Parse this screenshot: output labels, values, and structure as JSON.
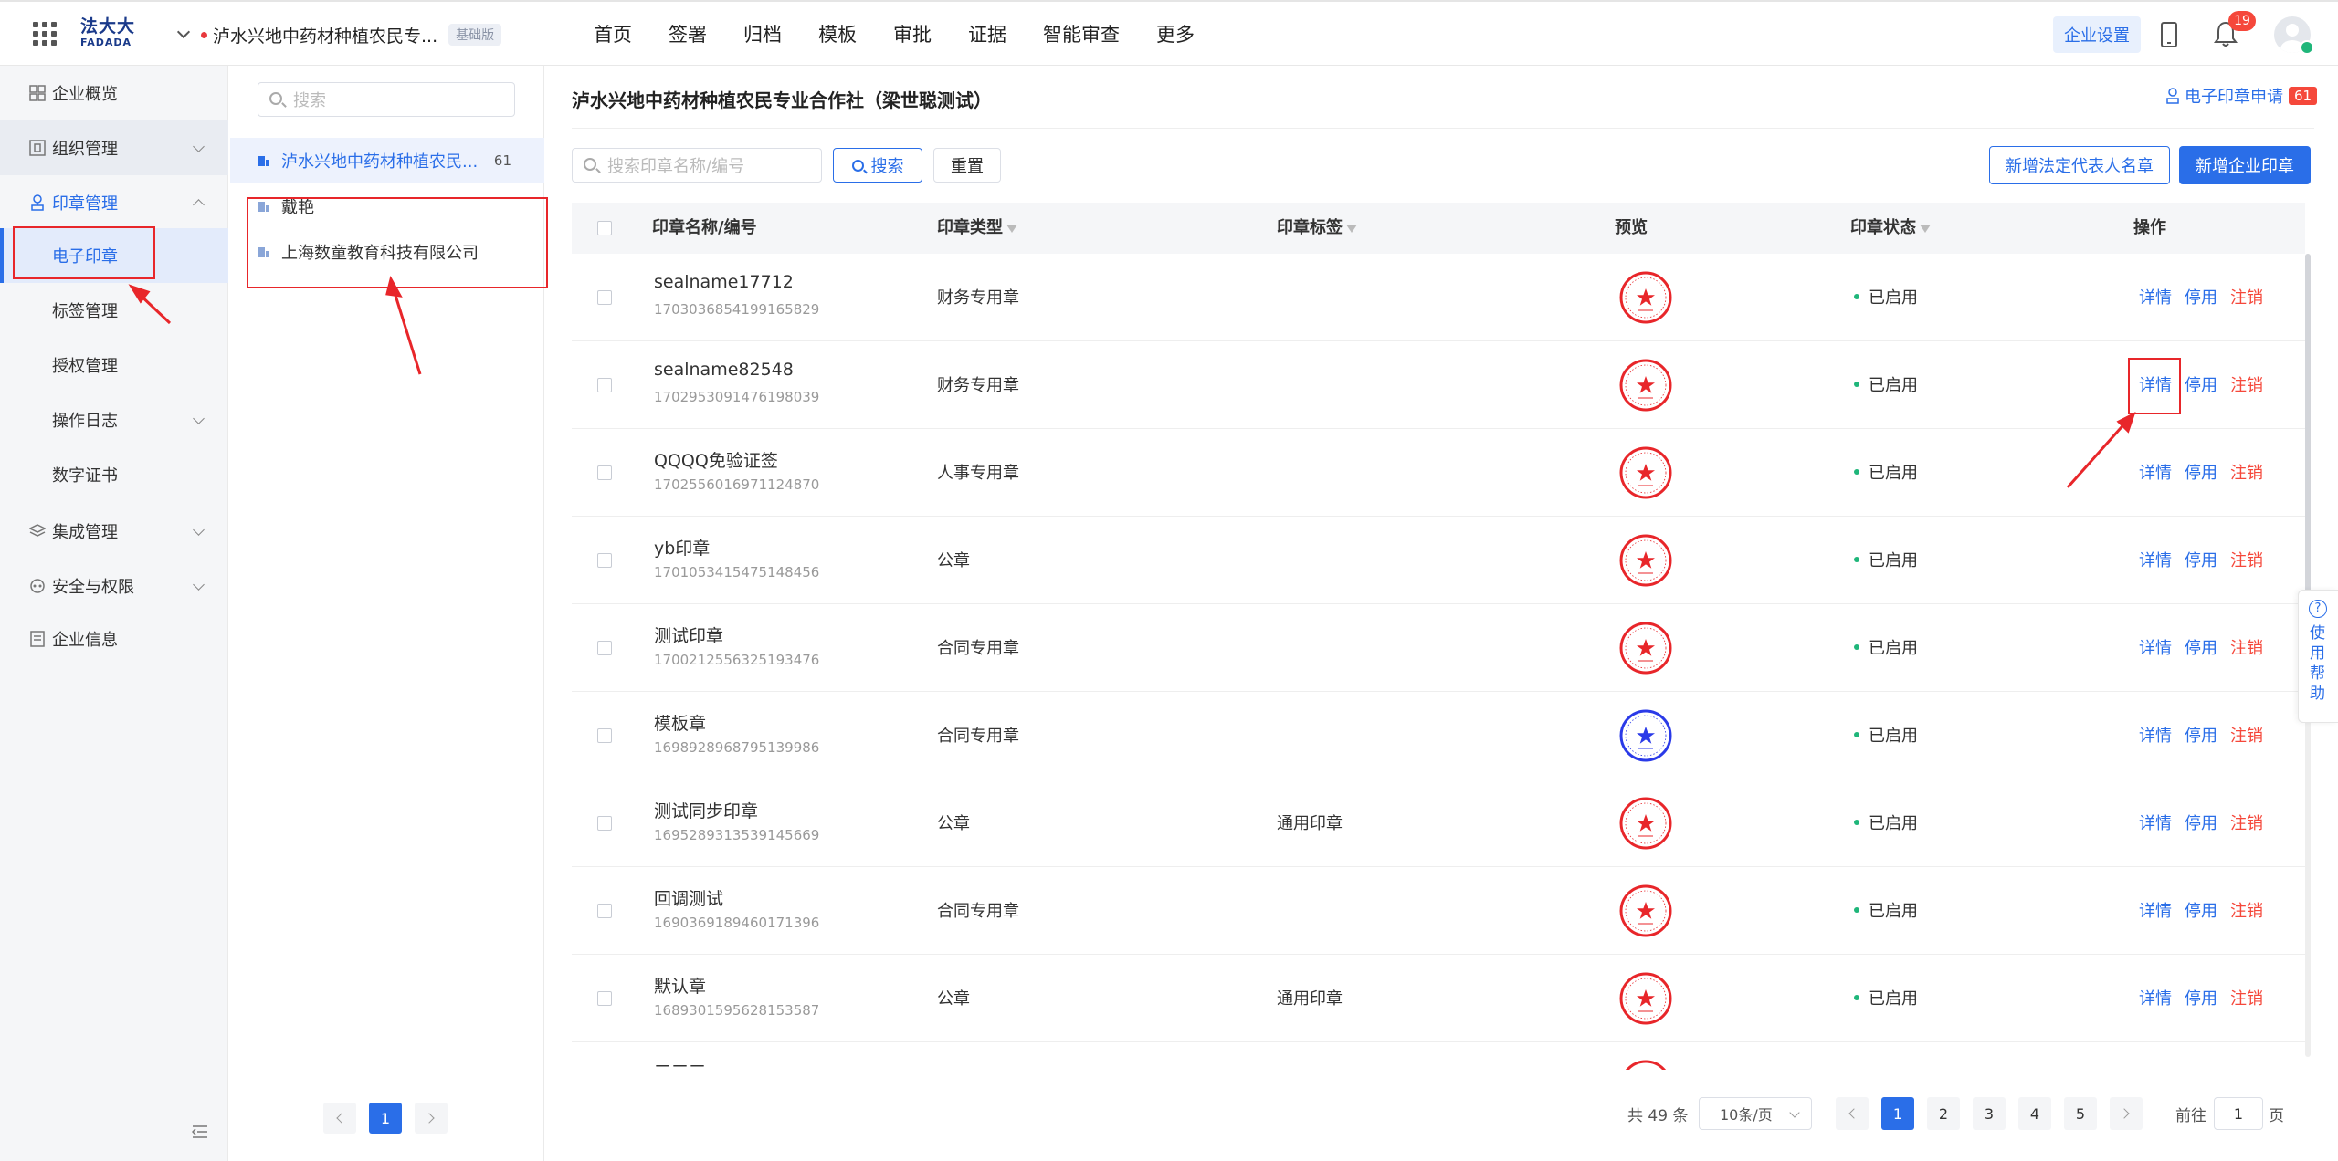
{
  "topbar": {
    "logo_cn": "法大大",
    "logo_en": "FADADA",
    "org_name": "泸水兴地中药材种植农民专...",
    "plan_badge": "基础版",
    "nav": [
      "首页",
      "签署",
      "归档",
      "模板",
      "审批",
      "证据",
      "智能审查",
      "更多"
    ],
    "settings_label": "企业设置",
    "notification_count": "19"
  },
  "sidebar": {
    "items": [
      {
        "label": "企业概览",
        "icon": "overview-icon"
      },
      {
        "label": "组织管理",
        "icon": "org-icon"
      },
      {
        "label": "印章管理",
        "icon": "seal-icon"
      },
      {
        "label": "集成管理",
        "icon": "layers-icon"
      },
      {
        "label": "安全与权限",
        "icon": "security-icon"
      },
      {
        "label": "企业信息",
        "icon": "info-icon"
      }
    ],
    "seal_sub": [
      "电子印章",
      "标签管理",
      "授权管理",
      "操作日志",
      "数字证书"
    ]
  },
  "org_tree": {
    "search_placeholder": "搜索",
    "orgs": [
      {
        "name": "泸水兴地中药材种植农民...",
        "count": "61"
      },
      {
        "name": "戴艳",
        "count": ""
      },
      {
        "name": "上海数童教育科技有限公司",
        "count": ""
      }
    ],
    "page": "1"
  },
  "main": {
    "title": "泸水兴地中药材种植农民专业合作社（梁世聪测试）",
    "seal_apply_label": "电子印章申请",
    "seal_apply_count": "61",
    "search_placeholder": "搜索印章名称/编号",
    "search_btn": "搜索",
    "reset_btn": "重置",
    "add_legal_btn": "新增法定代表人名章",
    "add_company_btn": "新增企业印章",
    "columns": [
      "印章名称/编号",
      "印章类型",
      "印章标签",
      "预览",
      "印章状态",
      "操作"
    ],
    "rows": [
      {
        "name": "sealname17712",
        "code": "1703036854199165829",
        "type": "财务专用章",
        "tag": "",
        "status": "已启用",
        "seal_color": "#e8262a"
      },
      {
        "name": "sealname82548",
        "code": "1702953091476198039",
        "type": "财务专用章",
        "tag": "",
        "status": "已启用",
        "seal_color": "#e8262a"
      },
      {
        "name": "QQQQ免验证签",
        "code": "1702556016971124870",
        "type": "人事专用章",
        "tag": "",
        "status": "已启用",
        "seal_color": "#e8262a"
      },
      {
        "name": "yb印章",
        "code": "1701053415475148456",
        "type": "公章",
        "tag": "",
        "status": "已启用",
        "seal_color": "#e8262a"
      },
      {
        "name": "测试印章",
        "code": "1700212556325193476",
        "type": "合同专用章",
        "tag": "",
        "status": "已启用",
        "seal_color": "#e8262a"
      },
      {
        "name": "模板章",
        "code": "1698928968795139986",
        "type": "合同专用章",
        "tag": "",
        "status": "已启用",
        "seal_color": "#2a3ae8"
      },
      {
        "name": "测试同步印章",
        "code": "1695289313539145669",
        "type": "公章",
        "tag": "通用印章",
        "status": "已启用",
        "seal_color": "#e8262a"
      },
      {
        "name": "回调测试",
        "code": "1690369189460171396",
        "type": "合同专用章",
        "tag": "",
        "status": "已启用",
        "seal_color": "#e8262a"
      },
      {
        "name": "默认章",
        "code": "1689301595628153587",
        "type": "公章",
        "tag": "通用印章",
        "status": "已启用",
        "seal_color": "#e8262a"
      }
    ],
    "actions": {
      "detail": "详情",
      "disable": "停用",
      "cancel": "注销"
    },
    "partial_row_name": "三三三"
  },
  "help": {
    "label": "使用帮助"
  },
  "pagination": {
    "total": "共 49 条",
    "page_size": "10条/页",
    "pages": [
      "1",
      "2",
      "3",
      "4",
      "5"
    ],
    "current": "1",
    "goto_label": "前往",
    "goto_value": "1",
    "page_unit": "页"
  },
  "colors": {
    "primary": "#2a6ee8",
    "danger": "#f5483b",
    "success": "#1fb67a",
    "annotation": "#e8262a"
  }
}
